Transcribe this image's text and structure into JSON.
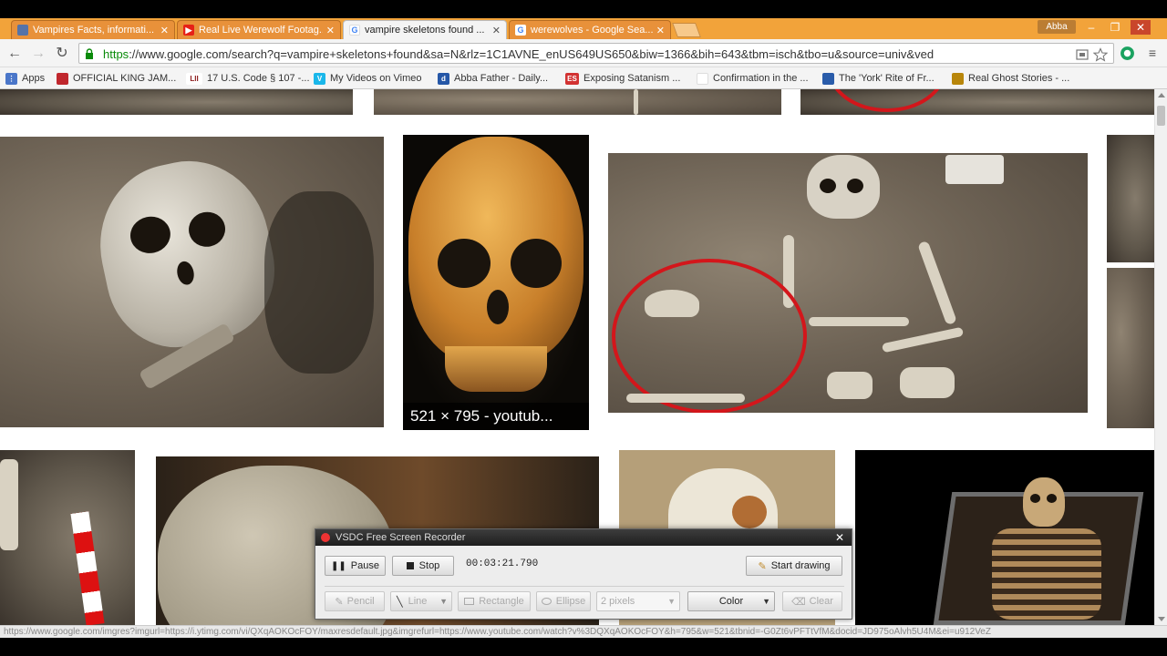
{
  "browser": {
    "tabs": [
      {
        "label": "Vampires Facts, informati...",
        "favicon": "document-icon",
        "color": "#5573a8"
      },
      {
        "label": "Real Live Werewolf Footag...",
        "favicon": "youtube-icon",
        "color": "#e62117"
      },
      {
        "label": "vampire skeletons found ...",
        "favicon": "google-icon",
        "color": "#4285f4"
      },
      {
        "label": "werewolves - Google Sea...",
        "favicon": "google-icon",
        "color": "#4285f4"
      }
    ],
    "active_tab_index": 2,
    "user": "Abba",
    "url_scheme": "https",
    "url_rest": "://www.google.com/search?q=vampire+skeletons+found&sa=N&rlz=1C1AVNE_enUS649US650&biw=1366&bih=643&tbm=isch&tbo=u&source=univ&ved"
  },
  "bookmarks": [
    {
      "label": "Apps",
      "color": "#4a76c9",
      "glyph": ""
    },
    {
      "label": "OFFICIAL KING JAM...",
      "color": "#c0272d",
      "glyph": ""
    },
    {
      "label": "17 U.S. Code § 107 -...",
      "color": "#8b1a1a",
      "glyph": "LII"
    },
    {
      "label": "My Videos on Vimeo",
      "color": "#1ab7ea",
      "glyph": "V"
    },
    {
      "label": "Abba Father - Daily...",
      "color": "#2557a7",
      "glyph": "d"
    },
    {
      "label": "Exposing Satanism ...",
      "color": "#d23232",
      "glyph": "ES"
    },
    {
      "label": "Confirmation in the ...",
      "color": "#ffffff",
      "glyph": ""
    },
    {
      "label": "The 'York' Rite of Fr...",
      "color": "#2a5caa",
      "glyph": ""
    },
    {
      "label": "Real Ghost Stories - ...",
      "color": "#b8860b",
      "glyph": ""
    }
  ],
  "results": {
    "hovered_caption": "521 × 795 - youtub..."
  },
  "recorder": {
    "title": "VSDC Free Screen Recorder",
    "pause_label": "Pause",
    "stop_label": "Stop",
    "elapsed": "00:03:21.790",
    "start_drawing_label": "Start drawing",
    "pencil_label": "Pencil",
    "line_label": "Line",
    "rectangle_label": "Rectangle",
    "ellipse_label": "Ellipse",
    "thickness_value": "2 pixels",
    "color_label": "Color",
    "clear_label": "Clear"
  },
  "status_url": "https://www.google.com/imgres?imgurl=https://i.ytimg.com/vi/QXqAOKOcFOY/maxresdefault.jpg&imgrefurl=https://www.youtube.com/watch?v%3DQXqAOKOcFOY&h=795&w=521&tbnid=-G0Zt6vPFTtVfM&docid=JD975oAlvh5U4M&ei=u912VeZ"
}
